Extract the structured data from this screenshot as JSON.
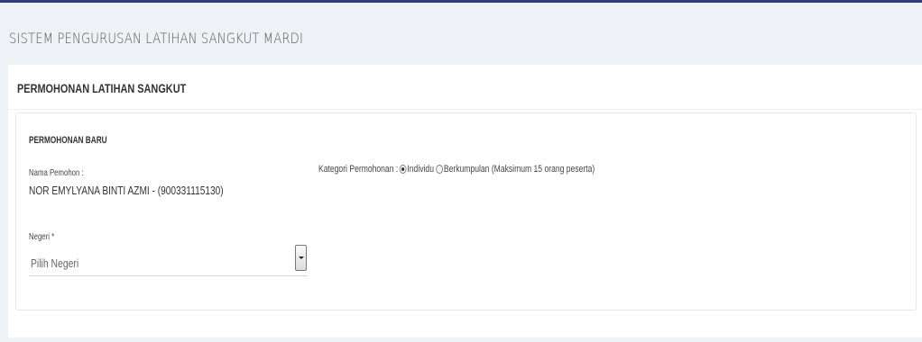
{
  "app": {
    "title": "SISTEM PENGURUSAN LATIHAN SANGKUT MARDI"
  },
  "portlet": {
    "title": "PERMOHONAN LATIHAN SANGKUT"
  },
  "form": {
    "section_title": "PERMOHONAN BARU",
    "applicant_label": "Nama Pemohon :",
    "applicant_value": "NOR EMYLYANA BINTI AZMI - (900331115130)",
    "category_label": "Kategori Permohonan :",
    "category_options": [
      "Individu",
      "Berkumpulan (Maksimum 15 orang peserta)"
    ],
    "category_selected": "Individu",
    "state_label": "Negeri *",
    "state_value": "Pilih Negeri"
  }
}
